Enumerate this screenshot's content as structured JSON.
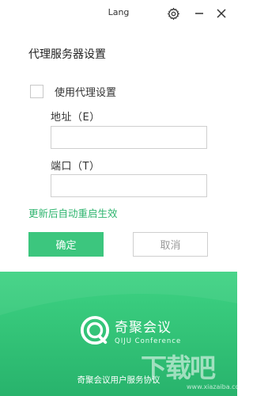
{
  "window": {
    "title": "Lang"
  },
  "page": {
    "heading": "代理服务器设置"
  },
  "proxy_toggle": {
    "label": "使用代理设置",
    "checked": false
  },
  "address_field": {
    "label": "地址（E）",
    "value": "",
    "placeholder": ""
  },
  "port_field": {
    "label": "端口（T）",
    "value": "",
    "placeholder": ""
  },
  "hint": {
    "text": "更新后自动重启生效"
  },
  "buttons": {
    "confirm_label": "确定",
    "cancel_label": "取消"
  },
  "brand": {
    "name": "奇聚会议",
    "subtitle": "QIJU Conference",
    "agreement_link": "奇聚会议用户服务协议"
  },
  "watermark": {
    "text": "下载吧",
    "url": "www.xiazaiba.com"
  },
  "colors": {
    "accent": "#3cc67e",
    "hint": "#2fb56f",
    "footer_top": "#3ed383",
    "footer_bottom": "#28b36c"
  },
  "icons": {
    "settings": "gear-icon",
    "minimize": "minimize-icon",
    "close": "close-icon",
    "logo": "qiju-logo-icon"
  }
}
